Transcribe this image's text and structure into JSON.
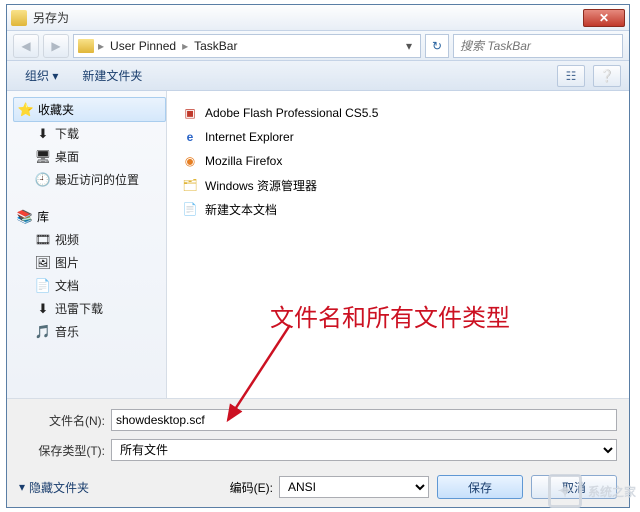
{
  "window": {
    "title": "另存为",
    "close_glyph": "✕"
  },
  "nav": {
    "back_glyph": "◀",
    "fwd_glyph": "▶",
    "crumb1": "User Pinned",
    "crumb2": "TaskBar",
    "sep": "▸",
    "dd_glyph": "▾",
    "refresh_glyph": "↻",
    "search_placeholder": "搜索 TaskBar"
  },
  "toolbar": {
    "organize": "组织",
    "organize_dd": "▾",
    "newfolder": "新建文件夹",
    "view_glyph": "☷",
    "help_glyph": "❔"
  },
  "sidebar": {
    "fav_header": "收藏夹",
    "fav_items": [
      {
        "icon": "⬇",
        "label": "下载"
      },
      {
        "icon": "🖥",
        "label": "桌面"
      },
      {
        "icon": "🕘",
        "label": "最近访问的位置"
      }
    ],
    "lib_header": "库",
    "lib_items": [
      {
        "icon": "🎞",
        "label": "视频"
      },
      {
        "icon": "🖼",
        "label": "图片"
      },
      {
        "icon": "📄",
        "label": "文档"
      },
      {
        "icon": "⬇",
        "label": "迅雷下载"
      },
      {
        "icon": "🎵",
        "label": "音乐"
      }
    ]
  },
  "files": [
    {
      "icon": "red",
      "label": "Adobe Flash Professional CS5.5"
    },
    {
      "icon": "blue-e",
      "label": "Internet Explorer"
    },
    {
      "icon": "orange",
      "label": "Mozilla Firefox"
    },
    {
      "icon": "folder",
      "label": "Windows 资源管理器"
    },
    {
      "icon": "doc",
      "label": "新建文本文档"
    }
  ],
  "annotation": "文件名和所有文件类型",
  "form": {
    "filename_label": "文件名(N):",
    "filename_value": "showdesktop.scf",
    "type_label": "保存类型(T):",
    "type_value": "所有文件",
    "encoding_label": "编码(E):",
    "encoding_value": "ANSI",
    "hide_folders": "隐藏文件夹",
    "save_btn": "保存",
    "cancel_btn": "取消"
  },
  "watermark": "系统之家"
}
